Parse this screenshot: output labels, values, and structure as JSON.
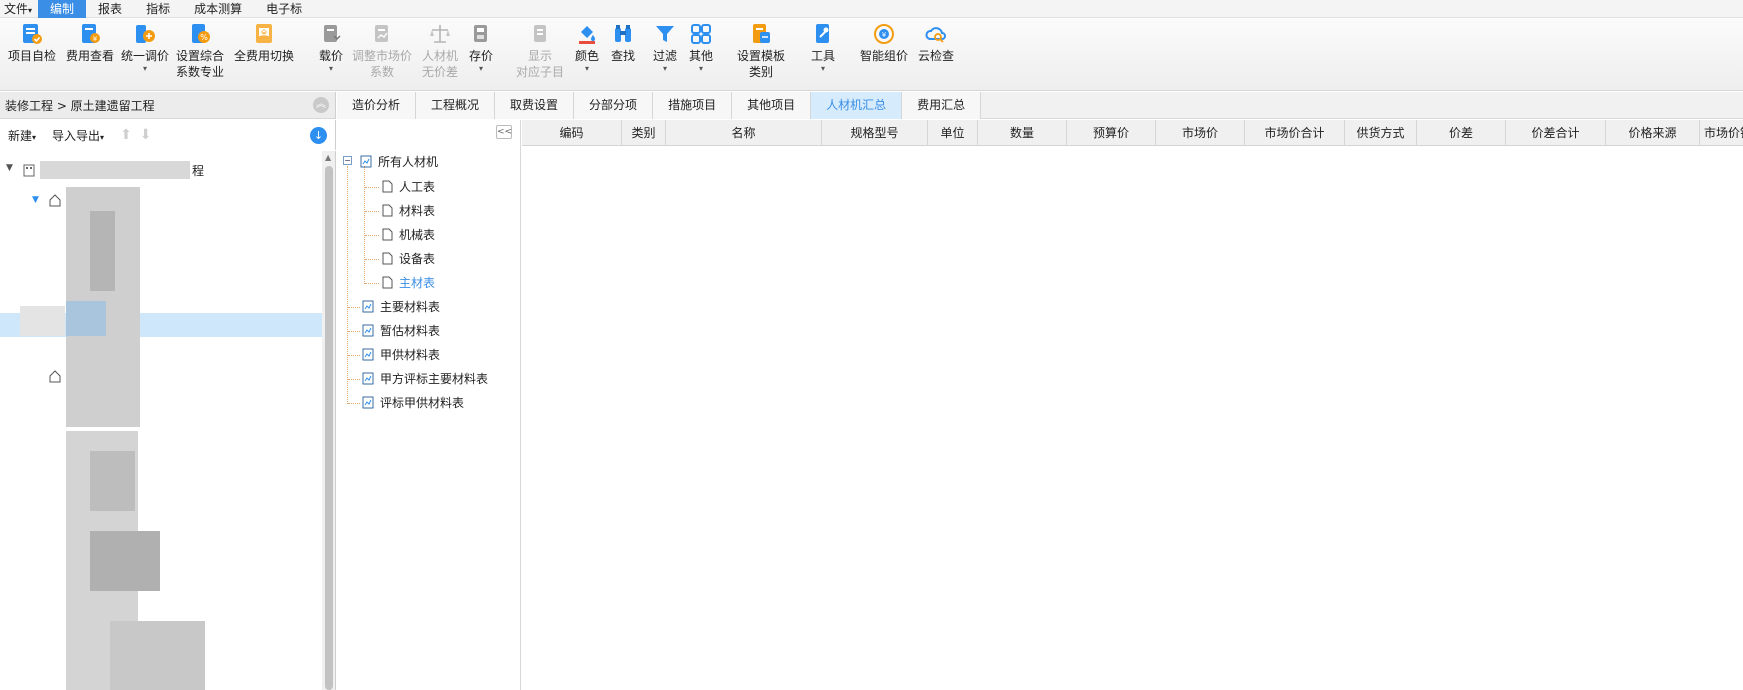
{
  "menu": [
    "文件",
    "编制",
    "报表",
    "指标",
    "成本测算",
    "电子标"
  ],
  "menu_active_index": 1,
  "ribbon": {
    "project_check": "项目自检",
    "fee_view": "费用查看",
    "unified_adjust": "统一调价",
    "set_coef_l1": "设置综合",
    "set_coef_l2": "系数专业",
    "fee_switch": "全费用切换",
    "carry_price": "载价",
    "adjust_market_l1": "调整市场价",
    "adjust_market_l2": "系数",
    "rcj_l1": "人材机",
    "rcj_l2": "无价差",
    "save_price": "存价",
    "show_sub_l1": "显示",
    "show_sub_l2": "对应子目",
    "color": "颜色",
    "find": "查找",
    "filter": "过滤",
    "other": "其他",
    "tpl_l1": "设置模板",
    "tpl_l2": "类别",
    "tools": "工具",
    "smart_price": "智能组价",
    "cloud_check": "云检查",
    "dropdown": "▾"
  },
  "left": {
    "breadcrumb": "装修工程 > 原土建遗留工程",
    "new": "新建",
    "import_export": "导入导出",
    "tree_root_suffix": "程"
  },
  "tabs": [
    "造价分析",
    "工程概况",
    "取费设置",
    "分部分项",
    "措施项目",
    "其他项目",
    "人材机汇总",
    "费用汇总"
  ],
  "tabs_active_index": 6,
  "category_tree": {
    "root": "所有人材机",
    "children": [
      "人工表",
      "材料表",
      "机械表",
      "设备表",
      "主材表"
    ],
    "others": [
      "主要材料表",
      "暂估材料表",
      "甲供材料表",
      "甲方评标主要材料表",
      "评标甲供材料表"
    ],
    "selected": "主材表"
  },
  "grid": {
    "columns": [
      "编码",
      "类别",
      "名称",
      "规格型号",
      "单位",
      "数量",
      "预算价",
      "市场价",
      "市场价合计",
      "供货方式",
      "价差",
      "价差合计",
      "价格来源",
      "市场价锁"
    ]
  },
  "colors": {
    "accent": "#3a8ee6",
    "selection": "#cfe7fb",
    "tab_active": "#d6ecfc"
  }
}
